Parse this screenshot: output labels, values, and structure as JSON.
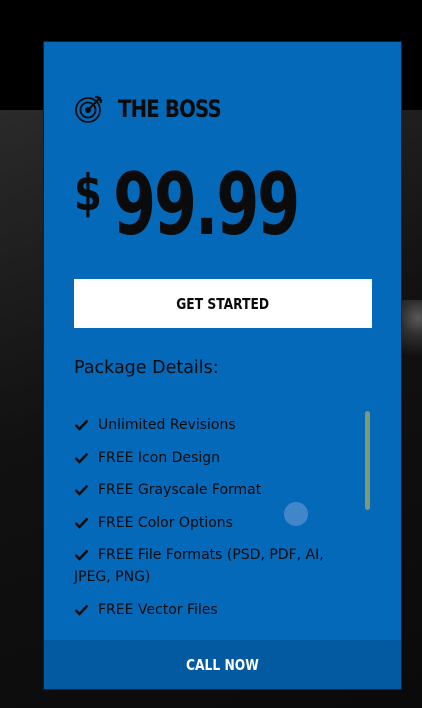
{
  "plan": {
    "icon": "target-arrow-icon",
    "name": "THE BOSS",
    "currency": "$",
    "amount": "99.99",
    "cta_label": "GET STARTED"
  },
  "details": {
    "title": "Package Details:",
    "check_icon": "check-icon",
    "features": [
      "Unlimited Revisions",
      "FREE Icon Design",
      "FREE Grayscale Format",
      "FREE Color Options",
      "FREE File Formats (PSD, PDF, AI, JPEG, PNG)",
      "FREE Vector Files"
    ]
  },
  "footer": {
    "label": "CALL NOW"
  },
  "colors": {
    "card_background": "#0469b9",
    "footer_background": "#035aa0",
    "text": "#0b0b0b",
    "button_background": "#ffffff"
  }
}
